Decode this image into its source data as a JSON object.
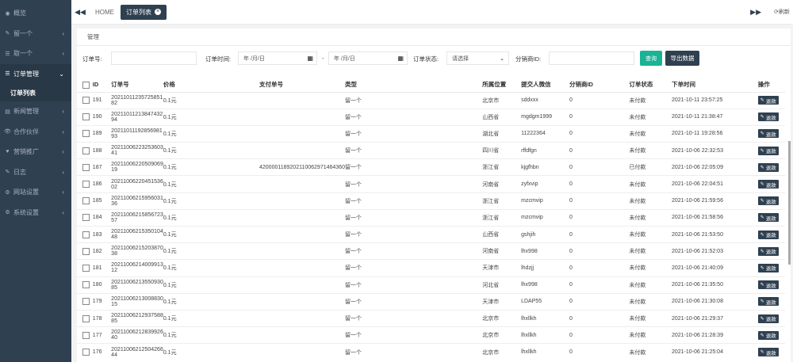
{
  "sidebar": {
    "items": [
      {
        "icon": "dashboard-icon",
        "glyph": "◉",
        "label": "概览"
      },
      {
        "icon": "list-icon",
        "glyph": "✎",
        "label": "留一个"
      },
      {
        "icon": "list-icon",
        "glyph": "☰",
        "label": "取一个"
      },
      {
        "icon": "order-icon",
        "glyph": "☰",
        "label": "订单管理"
      },
      {
        "icon": "news-icon",
        "glyph": "▤",
        "label": "新闻管理"
      },
      {
        "icon": "partner-icon",
        "glyph": "👁",
        "label": "合作伙伴"
      },
      {
        "icon": "marketing-icon",
        "glyph": "♥",
        "label": "营销推广"
      },
      {
        "icon": "log-icon",
        "glyph": "✎",
        "label": "日志"
      },
      {
        "icon": "site-settings-icon",
        "glyph": "⚙",
        "label": "网站设置"
      },
      {
        "icon": "system-settings-icon",
        "glyph": "⚙",
        "label": "系统设置"
      }
    ],
    "sub_item": "订单列表"
  },
  "topbar": {
    "home": "HOME",
    "active_tab": "订单列表",
    "refresh": "刷新"
  },
  "panel": {
    "tab": "管理"
  },
  "filters": {
    "order_no_label": "订单号:",
    "order_time_label": "订单时间:",
    "date_placeholder": "年 /月/日",
    "date_sep": "-",
    "status_label": "订单状态:",
    "status_value": "请选择",
    "distributor_label": "分销商ID:",
    "query_button": "查询",
    "export_button": "导出数据"
  },
  "table": {
    "headers": [
      "ID",
      "订单号",
      "价格",
      "支付单号",
      "类型",
      "所属位置",
      "提交人微信",
      "分销商ID",
      "订单状态",
      "下单时间",
      "操作"
    ],
    "refund_label": "退款",
    "rows": [
      [
        "191",
        "20211011235725851​82",
        "0.1元",
        "",
        "留一个",
        "北京市",
        "sddxxx",
        "0",
        "未付款",
        "2021-10-11 23:57:25"
      ],
      [
        "190",
        "20211011213847432​94",
        "0.1元",
        "",
        "留一个",
        "山西省",
        "mgdgm1999",
        "0",
        "未付款",
        "2021-10-11 21:38:47"
      ],
      [
        "189",
        "20211011192856981​93",
        "0.1元",
        "",
        "留一个",
        "湖北省",
        "11222364",
        "0",
        "未付款",
        "2021-10-11 19:28:56"
      ],
      [
        "188",
        "20211006223253603​41",
        "0.1元",
        "",
        "留一个",
        "四川省",
        "rffdfgn",
        "0",
        "未付款",
        "2021-10-06 22:32:53"
      ],
      [
        "187",
        "20211006220509069​19",
        "0.1元",
        "4200001189202110062971464360",
        "留一个",
        "浙江省",
        "kjgfhbn",
        "0",
        "已付款",
        "2021-10-06 22:05:09"
      ],
      [
        "186",
        "20211006220451536​02",
        "0.1元",
        "",
        "留一个",
        "河南省",
        "zyfxvip",
        "0",
        "未付款",
        "2021-10-06 22:04:51"
      ],
      [
        "185",
        "20211006215956031​36",
        "0.1元",
        "",
        "留一个",
        "浙江省",
        "mzcmvip",
        "0",
        "未付款",
        "2021-10-06 21:59:56"
      ],
      [
        "184",
        "20211006215856723​57",
        "0.1元",
        "",
        "留一个",
        "浙江省",
        "mzcmvip",
        "0",
        "未付款",
        "2021-10-06 21:58:56"
      ],
      [
        "183",
        "20211006215350104​48",
        "0.1元",
        "",
        "留一个",
        "山西省",
        "gshjih",
        "0",
        "未付款",
        "2021-10-06 21:53:50"
      ],
      [
        "182",
        "20211006215203870​38",
        "0.1元",
        "",
        "留一个",
        "河南省",
        "lhx998",
        "0",
        "未付款",
        "2021-10-06 21:52:03"
      ],
      [
        "181",
        "20211006214009913​12",
        "0.1元",
        "",
        "留一个",
        "天津市",
        "lhdzjj",
        "0",
        "未付款",
        "2021-10-06 21:40:09"
      ],
      [
        "180",
        "20211006213550930​85",
        "0.1元",
        "",
        "留一个",
        "河北省",
        "lhx998",
        "0",
        "未付款",
        "2021-10-06 21:35:50"
      ],
      [
        "179",
        "20211006213008830​15",
        "0.1元",
        "",
        "留一个",
        "天津市",
        "LDAP55",
        "0",
        "未付款",
        "2021-10-06 21:30:08"
      ],
      [
        "178",
        "20211006212937588​85",
        "0.1元",
        "",
        "留一个",
        "北京市",
        "lhxllkh",
        "0",
        "未付款",
        "2021-10-06 21:29:37"
      ],
      [
        "177",
        "20211006212839926​40",
        "0.1元",
        "",
        "留一个",
        "北京市",
        "lhxllkh",
        "0",
        "未付款",
        "2021-10-06 21:28:39"
      ],
      [
        "176",
        "20211006212504266​44",
        "0.1元",
        "",
        "留一个",
        "北京市",
        "lhxllkh",
        "0",
        "未付款",
        "2021-10-06 21:25:04"
      ]
    ]
  },
  "colors": {
    "sidebar_bg": "#2f4050",
    "accent_green": "#1ab394",
    "dark_button": "#2f4050"
  }
}
